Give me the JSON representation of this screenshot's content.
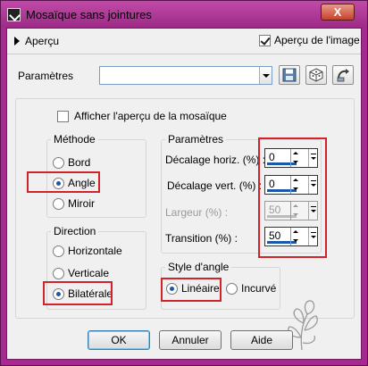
{
  "window": {
    "title": "Mosaïque sans jointures",
    "close_label": "X",
    "accent_color": "#a7298f"
  },
  "preview": {
    "toggle_label": "Aperçu",
    "show_image_label": "Aperçu de l'image",
    "show_image_checked": true
  },
  "presets": {
    "label": "Paramètres",
    "value": "",
    "save_icon": "save-icon",
    "random_icon": "dice-icon",
    "reset_icon": "reset-icon"
  },
  "show_tile_preview": {
    "label": "Afficher l'aperçu de la mosaïque",
    "checked": false
  },
  "method": {
    "title": "Méthode",
    "options": [
      "Bord",
      "Angle",
      "Miroir"
    ],
    "selected": "Angle"
  },
  "direction": {
    "title": "Direction",
    "options": [
      "Horizontale",
      "Verticale",
      "Bilatérale"
    ],
    "selected": "Bilatérale"
  },
  "parameters": {
    "title": "Paramètres",
    "fields": [
      {
        "label": "Décalage horiz. (%) :",
        "value": "0",
        "enabled": true
      },
      {
        "label": "Décalage vert. (%) :",
        "value": "0",
        "enabled": true
      },
      {
        "label": "Largeur (%) :",
        "value": "50",
        "enabled": false
      },
      {
        "label": "Transition (%) :",
        "value": "50",
        "enabled": true
      }
    ]
  },
  "corner_style": {
    "title": "Style d'angle",
    "options": [
      "Linéaire",
      "Incurvé"
    ],
    "selected": "Linéaire"
  },
  "buttons": {
    "ok": "OK",
    "cancel": "Annuler",
    "help": "Aide"
  },
  "highlight_color": "#d3232a"
}
